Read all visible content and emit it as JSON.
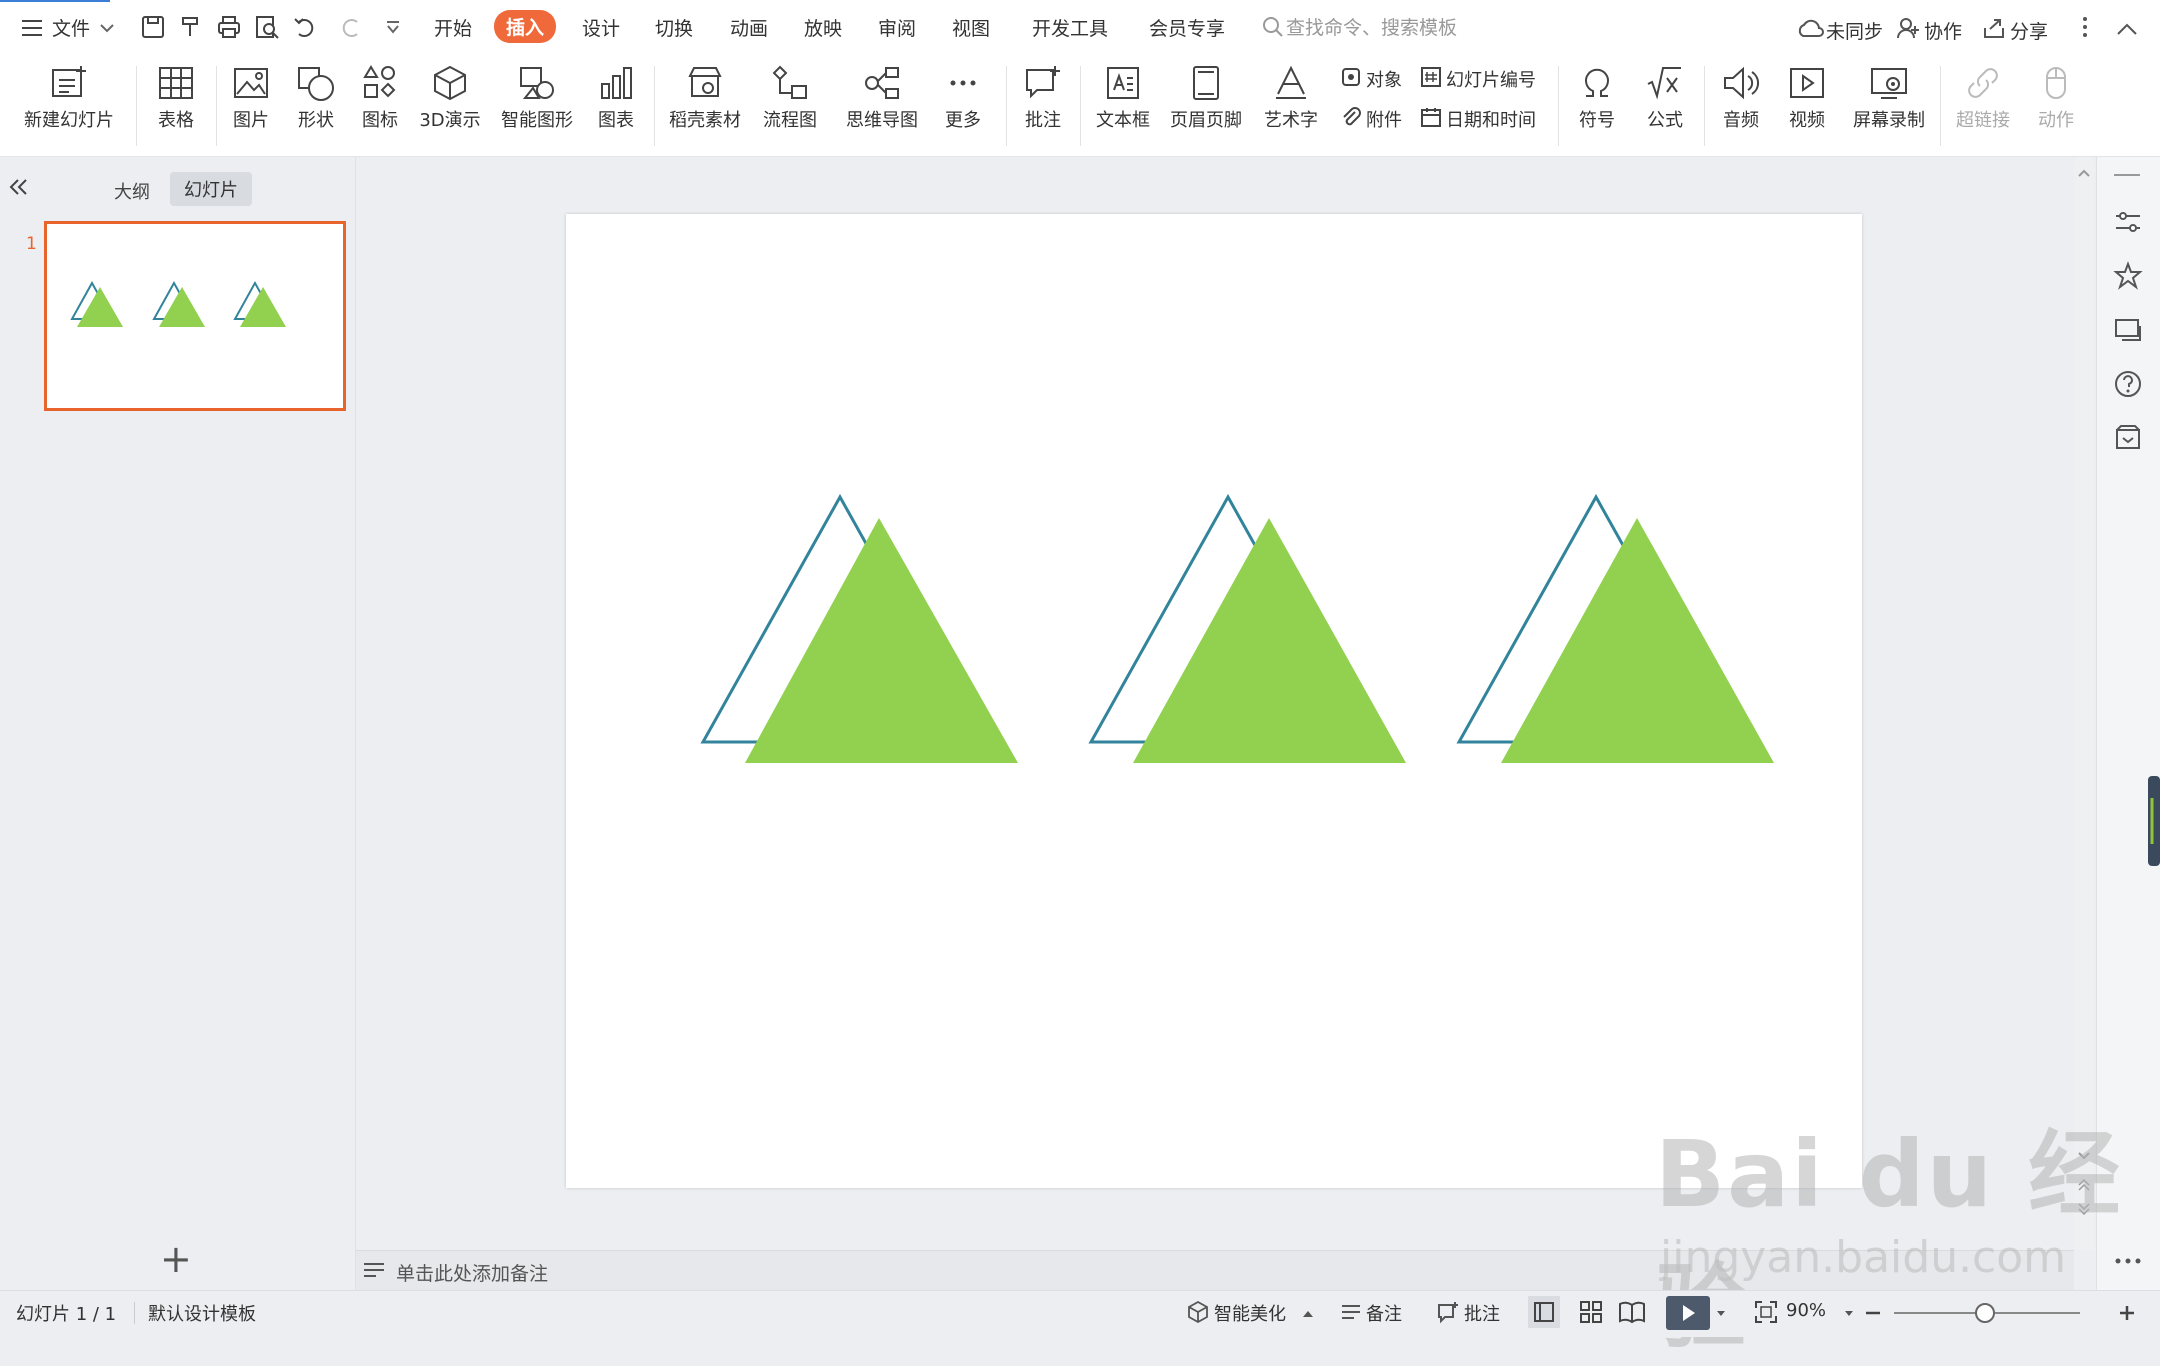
{
  "titlebar": {
    "menu_label": "文件",
    "tabs": [
      "开始",
      "插入",
      "设计",
      "切换",
      "动画",
      "放映",
      "审阅",
      "视图",
      "开发工具",
      "会员专享"
    ],
    "active_tab": "插入",
    "search_placeholder": "查找命令、搜索模板",
    "sync_label": "未同步",
    "collab_label": "协作",
    "share_label": "分享"
  },
  "ribbon": {
    "new_slide": "新建幻灯片",
    "table": "表格",
    "picture": "图片",
    "shape": "形状",
    "icon": "图标",
    "3d": "3D演示",
    "smartart": "智能图形",
    "chart": "图表",
    "material": "稻壳素材",
    "flowchart": "流程图",
    "mindmap": "思维导图",
    "more": "更多",
    "comment": "批注",
    "textbox": "文本框",
    "header_footer": "页眉页脚",
    "wordart": "艺术字",
    "object": "对象",
    "slide_number": "幻灯片编号",
    "attachment": "附件",
    "datetime": "日期和时间",
    "symbol": "符号",
    "formula": "公式",
    "audio": "音频",
    "video": "视频",
    "screen_record": "屏幕录制",
    "hyperlink": "超链接",
    "action": "动作"
  },
  "left_panel": {
    "tab_outline": "大纲",
    "tab_slides": "幻灯片",
    "slide_number": "1",
    "add_slide": "+"
  },
  "notes": {
    "placeholder": "单击此处添加备注"
  },
  "status": {
    "slide_counter": "幻灯片 1 / 1",
    "template": "默认设计模板",
    "beautify": "智能美化",
    "notes": "备注",
    "comments": "批注",
    "zoom": "90%"
  },
  "watermark": {
    "logo": "Bai du 经验",
    "url": "jingyan.baidu.com"
  },
  "colors": {
    "accent": "#f0693a",
    "triangle_fill": "#92d050",
    "triangle_outline": "#31849b",
    "thumbnail_border": "#e8642d"
  }
}
